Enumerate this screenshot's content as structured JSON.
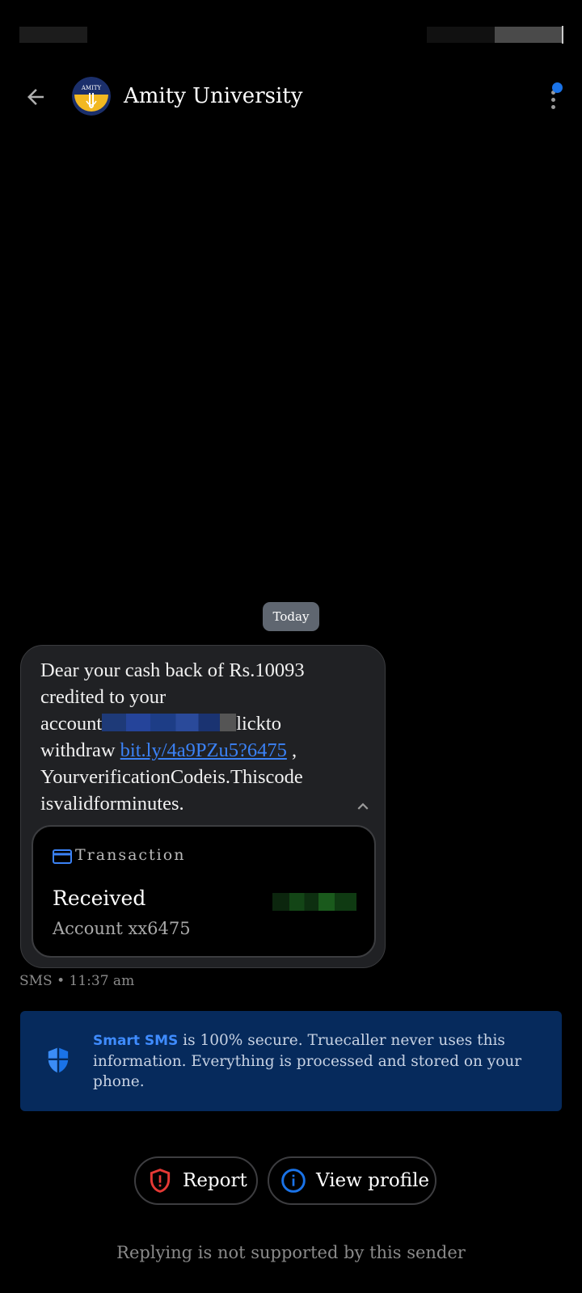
{
  "header": {
    "title": "Amity University",
    "avatar_text": "AMITY",
    "back_icon": "arrow-back-icon",
    "menu_icon": "more-vert-icon"
  },
  "conversation": {
    "date_chip": "Today",
    "message": {
      "line1": "Dear your cash back of Rs.10093",
      "line2": "credited to your",
      "line3_prefix": "account",
      "line3_suffix": "lickto",
      "line4_prefix": "withdraw ",
      "link": "bit.ly/4a9PZu5?6475",
      "line4_suffix": " ,",
      "line5": "YourverificationCodeis.Thiscode",
      "line6": "isvalidforminutes."
    },
    "transaction": {
      "label": "Transaction",
      "status": "Received",
      "account": "Account xx6475"
    },
    "meta": "SMS • 11:37 am"
  },
  "info_banner": {
    "brand": "Smart SMS",
    "text": " is 100% secure. Truecaller never uses this information. Everything is processed and stored on your phone."
  },
  "actions": {
    "report_label": "Report",
    "profile_label": "View profile"
  },
  "footer_note": "Replying is not supported by this sender",
  "colors": {
    "accent": "#1a73e8",
    "banner_bg": "#062a5c",
    "report_red": "#e53935",
    "link_blue": "#3b82f6"
  }
}
